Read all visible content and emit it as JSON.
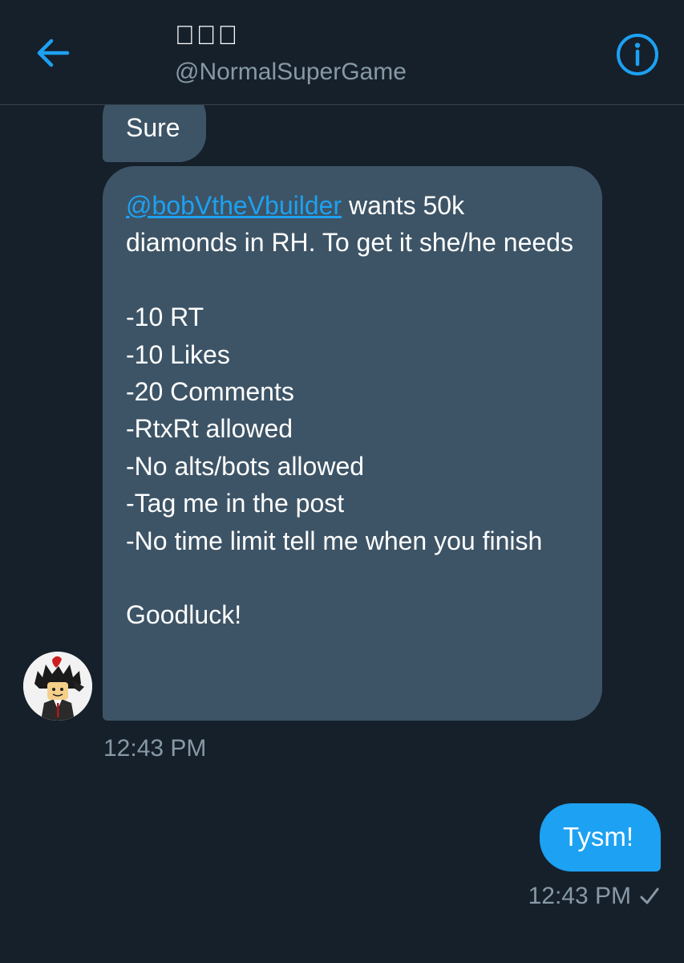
{
  "header": {
    "title": "􀀀􀀀􀀀",
    "handle": "@NormalSuperGame",
    "back_icon": "arrow-left-icon",
    "info_icon": "info-circle-icon",
    "accent_color": "#1da1f2"
  },
  "messages": {
    "received_1": "Sure",
    "received_2": {
      "mention": "@bobVtheVbuilder",
      "intro": " wants 50k diamonds in RH. To get it she/he needs",
      "lines": [
        "-10 RT",
        "-10 Likes",
        "-20 Comments",
        "-RtxRt allowed",
        "-No alts/bots allowed",
        "-Tag me in the post",
        "-No time limit tell me when you finish"
      ],
      "closing": "Goodluck!"
    },
    "received_time": "12:43 PM",
    "sent_1": "Tysm!",
    "sent_time": "12:43 PM",
    "sent_status_icon": "checkmark-icon"
  },
  "colors": {
    "background": "#15202b",
    "received_bubble": "#3d5466",
    "sent_bubble": "#1da1f2",
    "muted_text": "#8899a6"
  }
}
